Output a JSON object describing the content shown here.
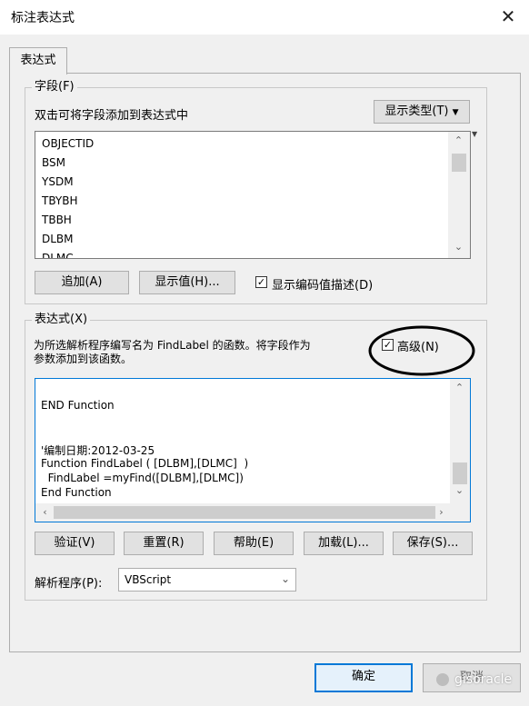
{
  "window": {
    "title": "标注表达式",
    "close_glyph": "✕"
  },
  "tab": {
    "label": "表达式"
  },
  "fields_group": {
    "title": "字段(F)",
    "hint": "双击可将字段添加到表达式中",
    "show_type_button": "显示类型(T)",
    "items": [
      "OBJECTID",
      "BSM",
      "YSDM",
      "TBYBH",
      "TBBH",
      "DLBM",
      "DLMC"
    ],
    "add_button": "追加(A)",
    "show_values_button": "显示值(H)...",
    "show_coded_desc_label": "显示编码值描述(D)",
    "show_coded_desc_checked": true
  },
  "expression_group": {
    "title": "表达式(X)",
    "description_line1": "为所选解析程序编写名为 FindLabel 的函数。将字段作为",
    "description_line2": "参数添加到该函数。",
    "advanced_label": "高级(N)",
    "advanced_checked": true,
    "code_lines": [
      "",
      "END Function",
      "",
      "",
      "'编制日期:2012-03-25",
      "Function FindLabel ( [DLBM],[DLMC]  )",
      "  FindLabel =myFind([DLBM],[DLMC])",
      "End Function"
    ],
    "buttons": {
      "verify": "验证(V)",
      "reset": "重置(R)",
      "help": "帮助(E)",
      "load": "加载(L)...",
      "save": "保存(S)..."
    },
    "parser_label": "解析程序(P):",
    "parser_value": "VBScript"
  },
  "footer": {
    "ok_button": "确定",
    "cancel_button": "取消"
  },
  "watermark": {
    "text": "gisoracle"
  },
  "colors": {
    "accent": "#0078d7",
    "annotation_circle": "#000000"
  }
}
